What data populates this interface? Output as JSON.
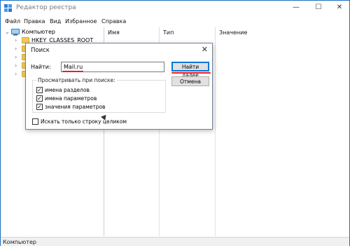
{
  "window": {
    "title": "Редактор реестра",
    "controls": {
      "minimize": "—",
      "maximize": "☐",
      "close": "✕"
    }
  },
  "menu": [
    "Файл",
    "Правка",
    "Вид",
    "Избранное",
    "Справка"
  ],
  "tree": {
    "root_label": "Компьютер",
    "visible_child": "HKEY_CLASSES_ROOT"
  },
  "list": {
    "columns": [
      "Имя",
      "Тип",
      "Значение"
    ]
  },
  "dialog": {
    "title": "Поиск",
    "find_label": "Найти:",
    "find_value": "Mail.ru",
    "find_next_button": "Найти далее",
    "cancel_button": "Отмена",
    "group_title": "Просматривать при поиске:",
    "options": [
      {
        "label": "имена разделов",
        "checked": true
      },
      {
        "label": "имена параметров",
        "checked": true
      },
      {
        "label": "значения параметров",
        "checked": true
      }
    ],
    "whole_string_option": {
      "label": "Искать только строку целиком",
      "checked": false
    }
  },
  "statusbar": {
    "path": "Компьютер"
  },
  "colors": {
    "highlight_red": "#e2202a",
    "accent_blue": "#0078d7",
    "folder": "#f3c95a"
  }
}
